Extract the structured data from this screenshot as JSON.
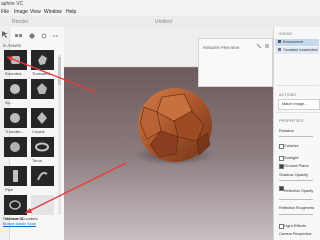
{
  "app": {
    "title_fragment": "aphire VC"
  },
  "menu": [
    "File",
    "Image",
    "View",
    "Window",
    "Help"
  ],
  "tabs": {
    "render": "Render",
    "document": "Untitled"
  },
  "assets_panel": {
    "label": "in Assets",
    "items": [
      {
        "label": "Rounded..."
      },
      {
        "label": "Truncated..."
      },
      {
        "label": "Sp..."
      },
      {
        "label": ""
      },
      {
        "label": "Truncate..."
      },
      {
        "label": "Crystal"
      },
      {
        "label": ""
      },
      {
        "label": "Torus"
      },
      {
        "label": "Pipe"
      },
      {
        "label": ""
      },
      {
        "label": "Mobius St..."
      },
      {
        "label": ""
      }
    ],
    "promo_line1": "Find more 3D content",
    "promo_line2": "Browse Adobe Stock"
  },
  "preview": {
    "title": "RENDER PREVIEW"
  },
  "right_panel": {
    "scene_header": "SCENE",
    "scene_items": [
      {
        "label": "Environment"
      },
      {
        "label": "Truncated Icosahedron"
      }
    ],
    "actions_header": "ACTIONS",
    "match_image_label": "Match Image...",
    "properties_header": "PROPERTIES",
    "rotation_label": "Rotation",
    "colorize_label": "Colorize",
    "sunlight_label": "Sunlight",
    "ground_plane_label": "Ground Plane",
    "shadow_opacity_label": "Shadow Opacity",
    "reflection_opacity_label": "Reflection Opacity",
    "reflection_roughness_label": "Reflection Roughness",
    "light_effects_label": "Light Effects",
    "camera_perspective_label": "Camera Perspective"
  },
  "colors": {
    "annotation_arrow": "#e63b3b",
    "selection": "#c6d8ee",
    "link": "#1b6ac9"
  }
}
